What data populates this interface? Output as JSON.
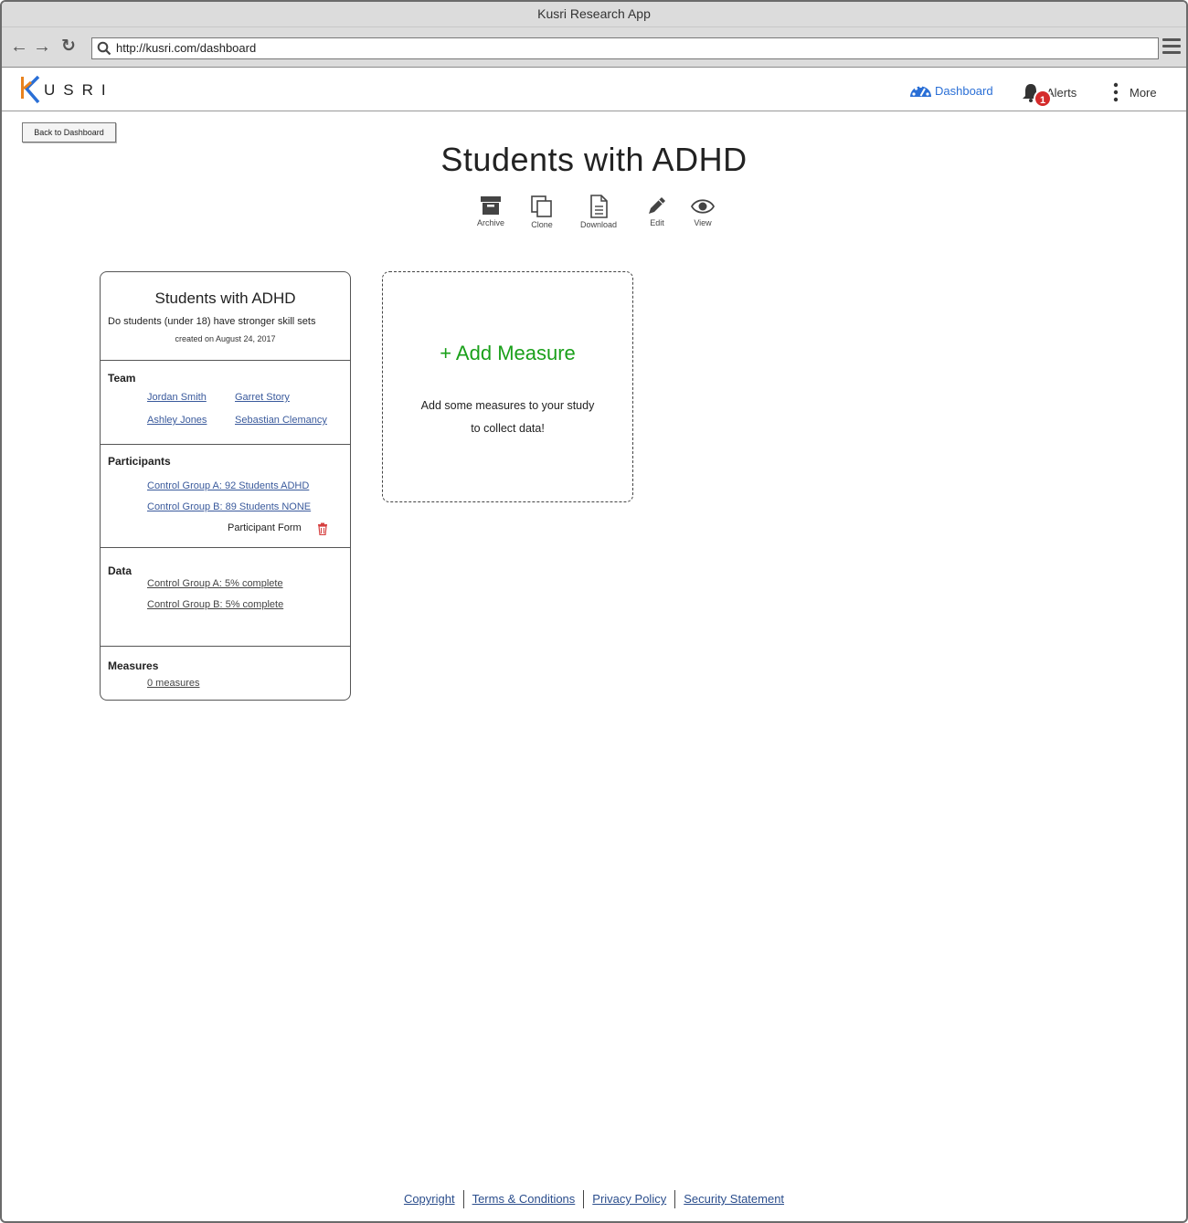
{
  "window": {
    "title": "Kusri Research App"
  },
  "browser": {
    "url": "http://kusri.com/dashboard"
  },
  "brand": {
    "logo_text": "USRI",
    "accent_orange": "#e8821e",
    "accent_blue": "#2a6fd6"
  },
  "nav": {
    "dashboard_label": "Dashboard",
    "alerts_label": "Alerts",
    "alerts_count": "1",
    "more_label": "More"
  },
  "page": {
    "back_label": "Back to Dashboard",
    "title": "Students with ADHD"
  },
  "actions": {
    "archive": "Archive",
    "clone": "Clone",
    "download": "Download",
    "edit": "Edit",
    "view": "View"
  },
  "study": {
    "title": "Students with ADHD",
    "question": "Do students (under 18) have stronger skill sets",
    "created": "created on August 24, 2017",
    "team": {
      "title": "Team",
      "members": [
        "Jordan Smith",
        "Garret Story",
        "Ashley Jones",
        "Sebastian Clemancy"
      ]
    },
    "participants": {
      "title": "Participants",
      "groups": [
        "Control Group A: 92 Students ADHD",
        "Control Group B: 89 Students NONE"
      ],
      "form_label": "Participant Form"
    },
    "data": {
      "title": "Data",
      "items": [
        "Control Group A: 5% complete",
        "Control Group B: 5% complete"
      ]
    },
    "measures": {
      "title": "Measures",
      "count_label": "0 measures "
    }
  },
  "add_measure": {
    "title": "+ Add Measure",
    "line1": "Add some measures to your study",
    "line2": "to collect data!"
  },
  "footer": {
    "links": [
      "Copyright",
      "Terms & Conditions",
      "Privacy Policy",
      "Security Statement"
    ]
  }
}
